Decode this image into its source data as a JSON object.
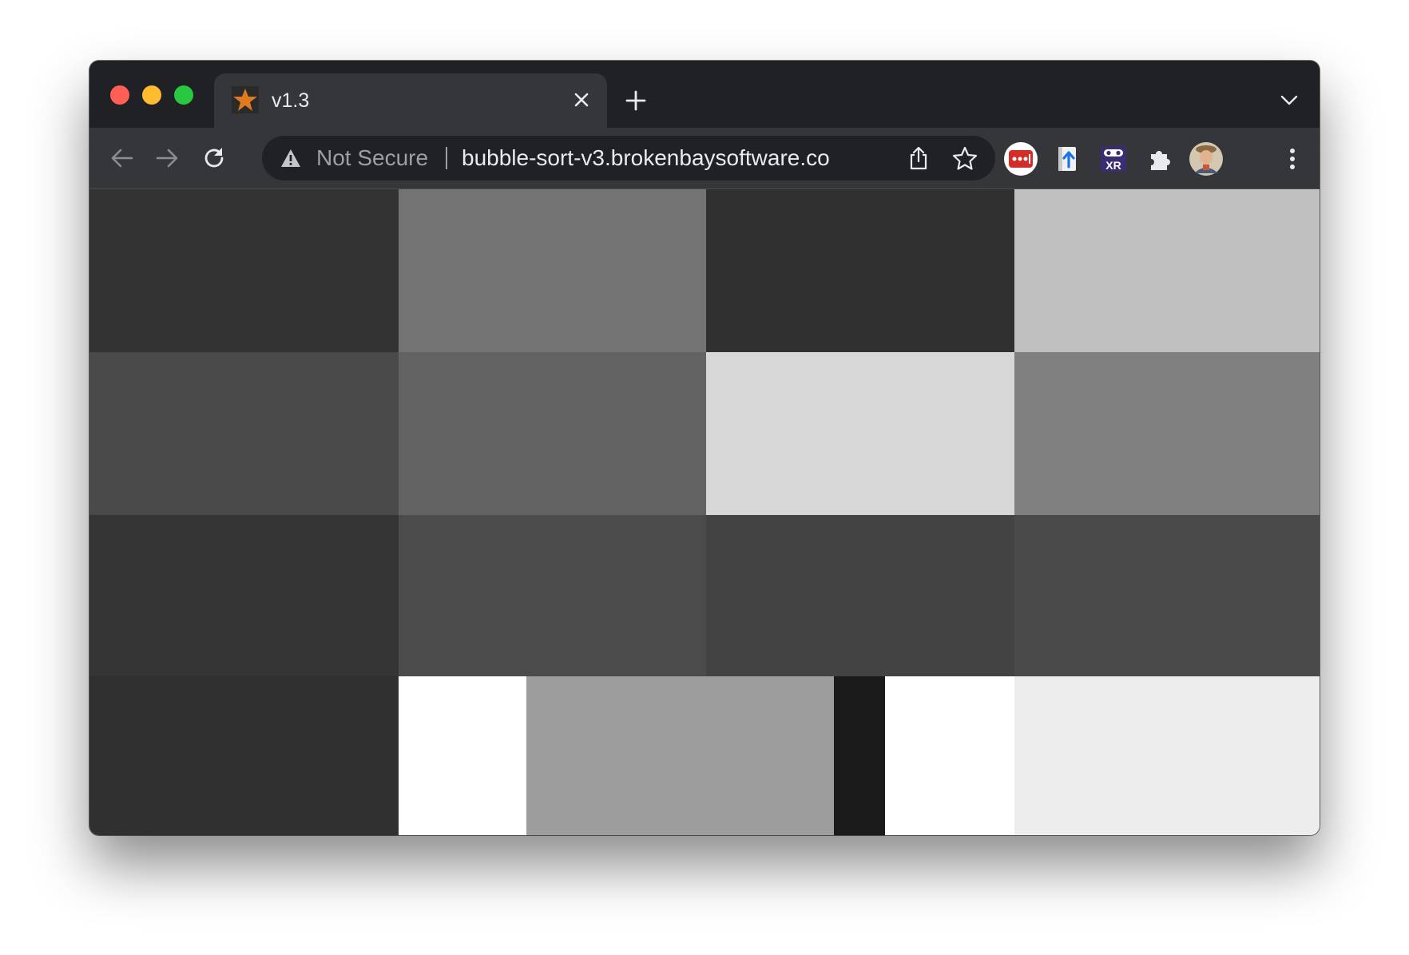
{
  "window": {
    "tab": {
      "title": "v1.3"
    }
  },
  "toolbar": {
    "security_label": "Not Secure",
    "url": "bubble-sort-v3.brokenbaysoftware.co"
  },
  "icons": [
    "close-window",
    "minimize-window",
    "maximize-window",
    "star-favicon",
    "close-tab-icon",
    "new-tab-icon",
    "tab-list-icon",
    "back-arrow-icon",
    "forward-arrow-icon",
    "reload-icon",
    "warning-icon",
    "share-icon",
    "bookmark-star-icon",
    "lastpass-icon",
    "upload-extension-icon",
    "xr-extension-icon",
    "puzzle-icon",
    "avatar",
    "more-vert-icon"
  ],
  "grid": {
    "colors": {
      "row1": [
        "#333333",
        "#737373",
        "#303030",
        "#c0c0c0"
      ],
      "row2": [
        "#4a4a4a",
        "#636363",
        "#d7d7d7",
        "#808080"
      ],
      "row3": [
        "#353535",
        "#4b4b4b",
        "#434343",
        "#4a4a4a"
      ],
      "row4": [
        "#303030",
        "#ffffff",
        "#9d9d9d",
        "#1b1b1b",
        "#ffffff",
        "#ededed"
      ]
    }
  }
}
